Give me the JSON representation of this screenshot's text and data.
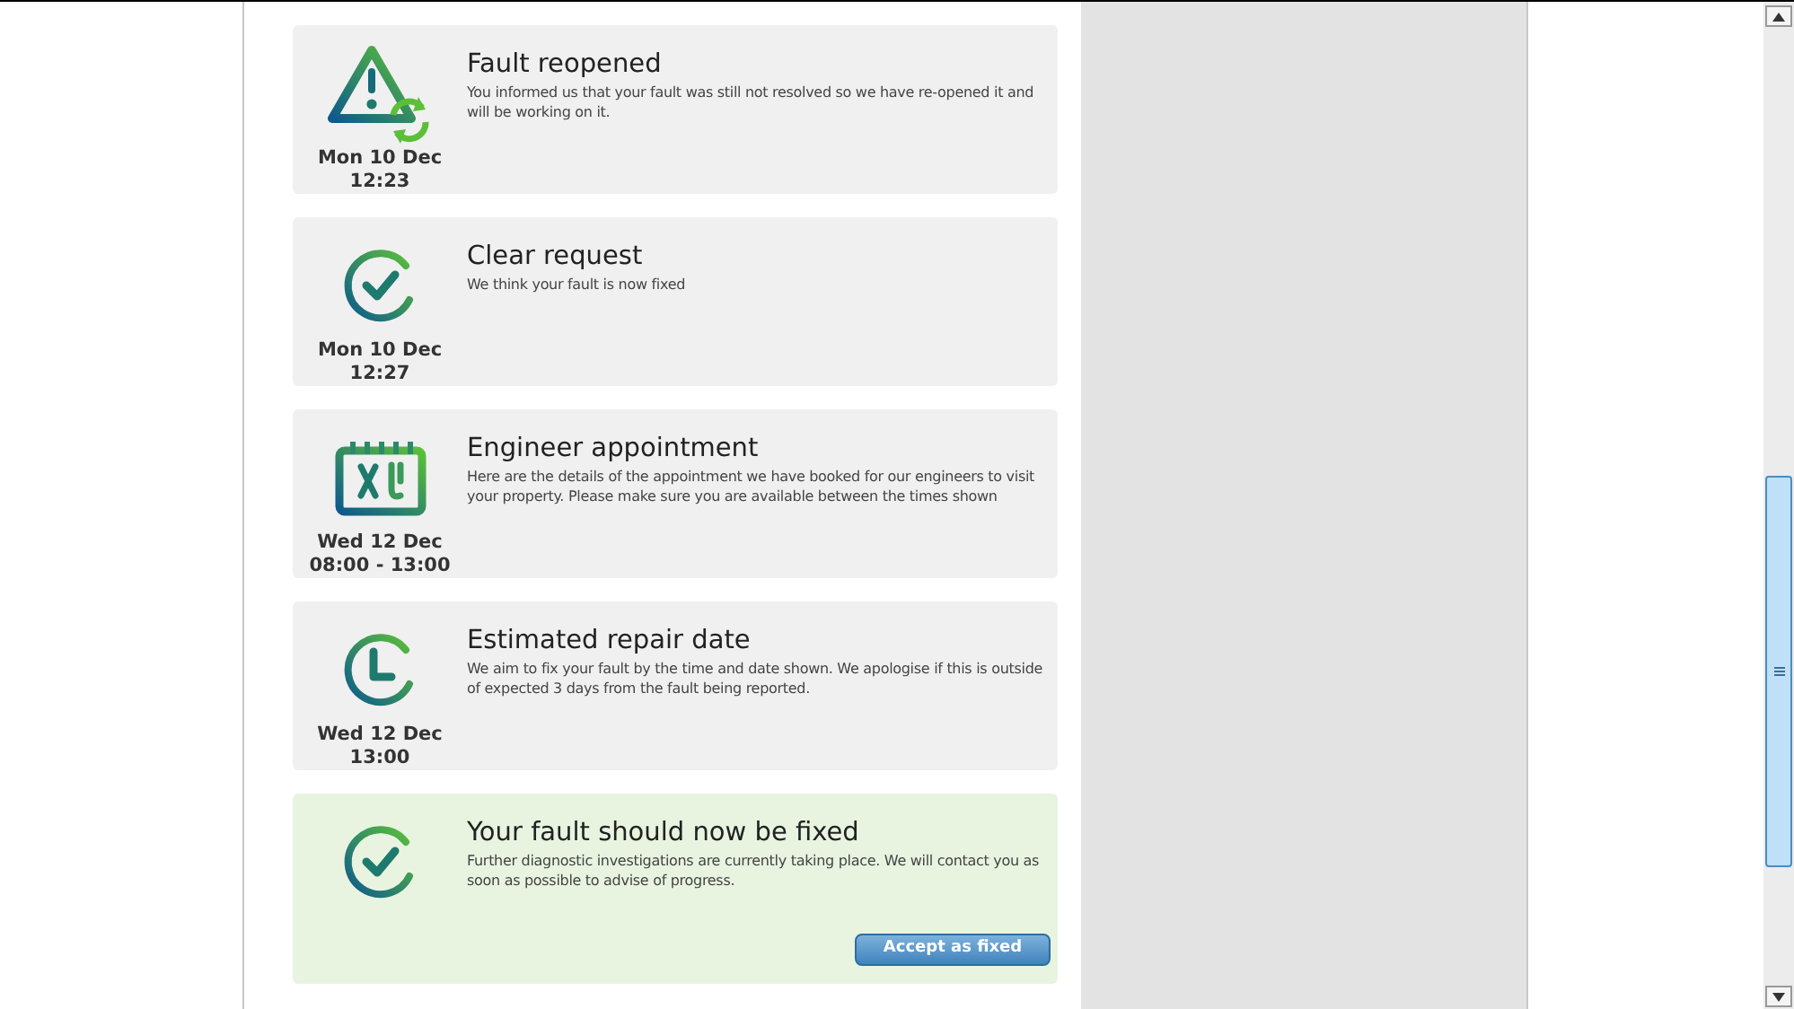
{
  "events": [
    {
      "kind": "warning",
      "title": "Fault reopened",
      "text": "You informed us that your fault was still not resolved so we have re-opened it and will be working on it.",
      "date": "Mon 10 Dec",
      "time": "12:23",
      "highlighted": false
    },
    {
      "kind": "check",
      "title": "Clear request",
      "text": "We think your fault is now fixed",
      "date": "Mon 10 Dec",
      "time": "12:27",
      "highlighted": false
    },
    {
      "kind": "calendar",
      "title": "Engineer appointment",
      "text": "Here are the details of the appointment we have booked for our engineers to visit your property. Please make sure you are available between the times shown",
      "date": "Wed 12 Dec",
      "time": "08:00 - 13:00",
      "highlighted": false
    },
    {
      "kind": "clock",
      "title": "Estimated repair date",
      "text": "We aim to fix your fault by the time and date shown. We apologise if this is outside of expected 3 days from the fault being reported.",
      "date": "Wed 12 Dec",
      "time": "13:00",
      "highlighted": false
    },
    {
      "kind": "check",
      "title": "Your fault should now be fixed",
      "text": "Further diagnostic investigations are currently taking place. We will contact you as soon as possible to advise of progress.",
      "highlighted": true,
      "button": "Accept as fixed"
    }
  ]
}
